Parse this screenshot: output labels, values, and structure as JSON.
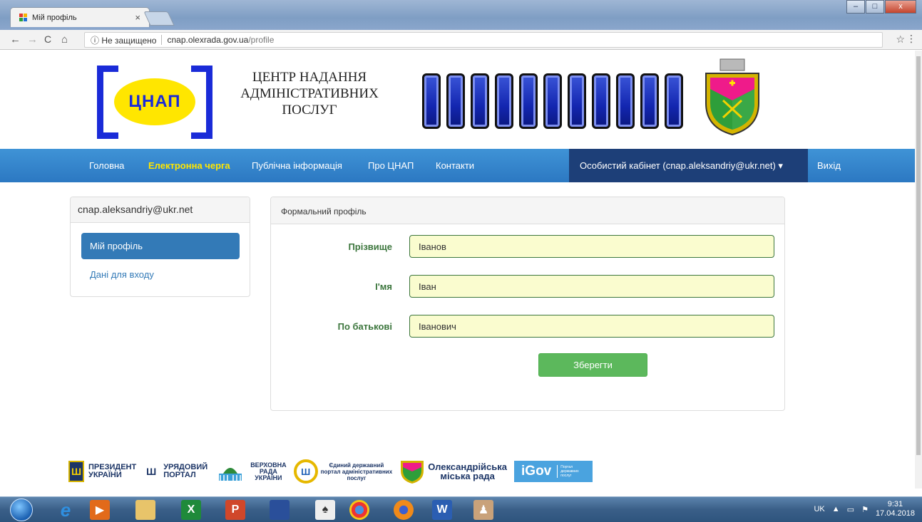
{
  "browser": {
    "tab_title": "Мій профіль",
    "tab_close": "×",
    "back": "←",
    "forward": "→",
    "reload": "C",
    "home": "⌂",
    "security_label": "ⓘ Не защищено",
    "url_host": "cnap.olexrada.gov.ua",
    "url_path": "/profile",
    "bookmark": "☆",
    "menu": "⋮",
    "win_min": "–",
    "win_max": "□",
    "win_close": "x"
  },
  "header": {
    "logo_text": "ЦНАП",
    "centre_title_1": "ЦЕНТР НАДАННЯ",
    "centre_title_2": "АДМІНІСТРАТИВНИХ",
    "centre_title_3": "ПОСЛУГ",
    "city_name": "ОЛЕКСАНДРІЯ"
  },
  "nav": {
    "items": [
      {
        "label": "Головна"
      },
      {
        "label": "Електронна черга"
      },
      {
        "label": "Публічна інформація"
      },
      {
        "label": "Про ЦНАП"
      },
      {
        "label": "Контакти"
      }
    ],
    "cabinet_label": "Особистий кабінет (cnap.aleksandriy@ukr.net) ▾",
    "logout_label": "Вихід"
  },
  "sidebar": {
    "email": "cnap.aleksandriy@ukr.net",
    "items": [
      {
        "label": "Мій профіль"
      },
      {
        "label": "Дані для входу"
      }
    ]
  },
  "form": {
    "title": "Формальний профіль",
    "fields": [
      {
        "label": "Прізвище",
        "value": "Іванов"
      },
      {
        "label": "І'мя",
        "value": "Іван"
      },
      {
        "label": "По батькові",
        "value": "Іванович"
      }
    ],
    "save_label": "Зберегти"
  },
  "footer": {
    "president_1": "ПРЕЗИДЕНТ",
    "president_2": "УКРАЇНИ",
    "gov_1": "УРЯДОВИЙ",
    "gov_2": "ПОРТАЛ",
    "rada_1": "ВЕРХОВНА",
    "rada_2": "РАДА",
    "rada_3": "УКРАЇНИ",
    "portal_1": "Єдиний державний",
    "portal_2": "портал адміністративних",
    "portal_3": "послуг",
    "council_1": "Олександрійська",
    "council_2": "міська рада",
    "igov": "iGov",
    "igov_small": "Портал державних послуг"
  },
  "taskbar": {
    "lang": "UK",
    "time": "9:31",
    "date": "17.04.2018"
  }
}
